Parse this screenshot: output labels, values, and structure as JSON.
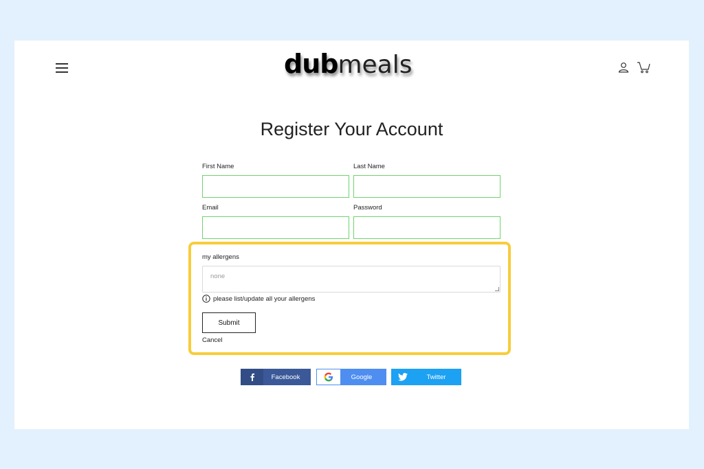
{
  "header": {
    "logo_bold": "dub",
    "logo_light": "meals"
  },
  "page_title": "Register Your Account",
  "form": {
    "first_name_label": "First Name",
    "first_name_value": "",
    "last_name_label": "Last Name",
    "last_name_value": "",
    "email_label": "Email",
    "email_value": "",
    "password_label": "Password",
    "password_value": "",
    "allergens_label": "my allergens",
    "allergens_placeholder": "none",
    "allergens_hint": "please list/update all your allergens",
    "submit_label": "Submit",
    "cancel_label": "Cancel"
  },
  "social": {
    "facebook_label": "Facebook",
    "google_label": "Google",
    "twitter_label": "Twitter"
  },
  "colors": {
    "background": "#e3f0fd",
    "field_border": "#6fd36f",
    "highlight": "#f8cc3a",
    "facebook": "#3b5998",
    "google": "#4e8ef0",
    "twitter": "#1da1f2"
  }
}
